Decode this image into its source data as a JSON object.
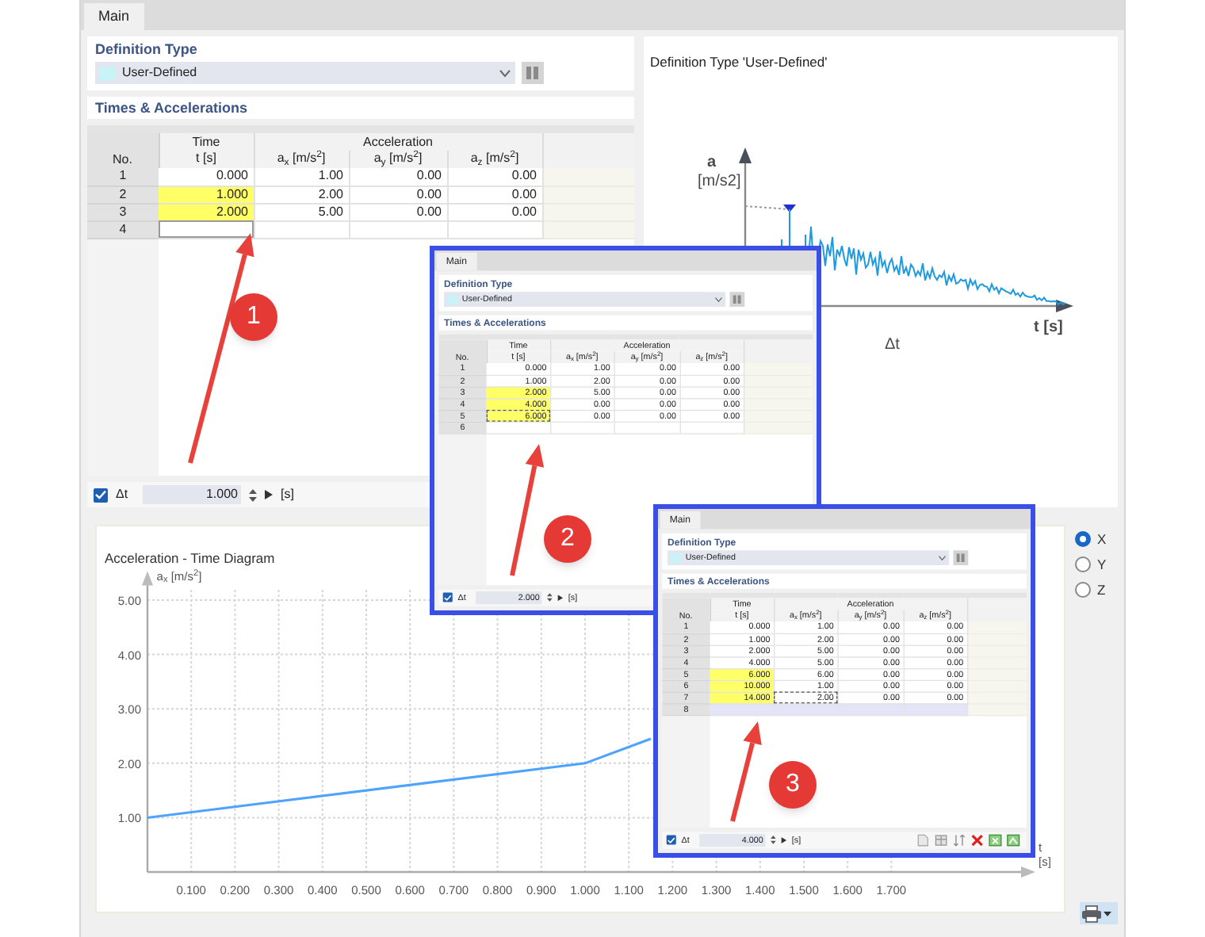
{
  "tabs": [
    {
      "label": "Main",
      "selected": true
    }
  ],
  "editor": {
    "definition_type_label": "Definition Type",
    "definition_type": "User-Defined",
    "table_title": "Times & Accelerations",
    "table": {
      "column_groups": [
        "Time",
        "Acceleration"
      ],
      "columns": [
        "No.",
        "t [s]",
        "a$_{x}$ [m/s$^{2}$]",
        "a$_{y}$ [m/s$^{2}$]",
        "a$_{z}$ [m/s$^{2}$]"
      ],
      "rows": [
        {
          "no": "1",
          "time": "0.000",
          "ax": "1.00",
          "ay": "0.00",
          "az": "0.00",
          "highlighted": false,
          "selected": false,
          "time_focused": false,
          "ax_focused": false
        },
        {
          "no": "2",
          "time": "1.000",
          "ax": "2.00",
          "ay": "0.00",
          "az": "0.00",
          "highlighted": true,
          "selected": false,
          "time_focused": false,
          "ax_focused": false
        },
        {
          "no": "3",
          "time": "2.000",
          "ax": "5.00",
          "ay": "0.00",
          "az": "0.00",
          "highlighted": true,
          "selected": false,
          "time_focused": false,
          "ax_focused": false
        },
        {
          "no": "4",
          "highlighted": false,
          "selected": false,
          "time_focused": true,
          "ax_focused": false
        }
      ]
    },
    "delta_t": {
      "checked": true,
      "label": "Δt",
      "value": "1.000",
      "unit": "[s]"
    }
  },
  "diagram_panel": {
    "title": "Definition Type 'User-Defined'",
    "y_axis_label": "a",
    "y_axis_unit": "[m/s2]",
    "x_axis_label": "t [s]",
    "interval_label": "Δt"
  },
  "chart_panel": {
    "title": "Acceleration - Time Diagram",
    "chart_data": {
      "type": "line",
      "xlabel": "t [s]",
      "ylabel": "a$_{x}$ [m/s$^{2}$]",
      "x": [
        0,
        1,
        1.15
      ],
      "series": [
        {
          "color": "#4da3ff",
          "values": [
            1,
            2,
            2.45
          ]
        }
      ],
      "xlim": [
        0,
        2
      ],
      "ylim": [
        0,
        5.3
      ],
      "grid": true,
      "xticks": [
        {
          "value": 0.1,
          "label": "0.100"
        },
        {
          "value": 0.2,
          "label": "0.200"
        },
        {
          "value": 0.3,
          "label": "0.300"
        },
        {
          "value": 0.4,
          "label": "0.400"
        },
        {
          "value": 0.5,
          "label": "0.500"
        },
        {
          "value": 0.6,
          "label": "0.600"
        },
        {
          "value": 0.7,
          "label": "0.700"
        },
        {
          "value": 0.8,
          "label": "0.800"
        },
        {
          "value": 0.9,
          "label": "0.900"
        },
        {
          "value": 1.0,
          "label": "1.000"
        },
        {
          "value": 1.1,
          "label": "1.100"
        },
        {
          "value": 1.2,
          "label": "1.200"
        },
        {
          "value": 1.3,
          "label": "1.300"
        },
        {
          "value": 1.4,
          "label": "1.400"
        },
        {
          "value": 1.5,
          "label": "1.500"
        },
        {
          "value": 1.6,
          "label": "1.600"
        },
        {
          "value": 1.7,
          "label": "1.700"
        }
      ],
      "yticks": [
        {
          "value": 1,
          "label": "1.00"
        },
        {
          "value": 2,
          "label": "2.00"
        },
        {
          "value": 3,
          "label": "3.00"
        },
        {
          "value": 4,
          "label": "4.00"
        },
        {
          "value": 5,
          "label": "5.00"
        }
      ]
    }
  },
  "direction_options": [
    {
      "label": "X",
      "selected": true
    },
    {
      "label": "Y",
      "selected": false
    },
    {
      "label": "Z",
      "selected": false
    }
  ],
  "screenshots": [
    {
      "tabs": [
        {
          "label": "Main",
          "selected": true
        }
      ],
      "editor": {
        "definition_type_label": "Definition Type",
        "definition_type": "User-Defined",
        "table_title": "Times & Accelerations",
        "table": {
          "column_groups": [
            "Time",
            "Acceleration"
          ],
          "columns": [
            "No.",
            "t [s]",
            "a$_{x}$ [m/s$^{2}$]",
            "a$_{y}$ [m/s$^{2}$]",
            "a$_{z}$ [m/s$^{2}$]"
          ],
          "rows": [
            {
              "no": "1",
              "time": "0.000",
              "ax": "1.00",
              "ay": "0.00",
              "az": "0.00",
              "highlighted": false,
              "selected": false,
              "time_focused": false,
              "ax_focused": false
            },
            {
              "no": "2",
              "time": "1.000",
              "ax": "2.00",
              "ay": "0.00",
              "az": "0.00",
              "highlighted": false,
              "selected": false,
              "time_focused": false,
              "ax_focused": false
            },
            {
              "no": "3",
              "time": "2.000",
              "ax": "5.00",
              "ay": "0.00",
              "az": "0.00",
              "highlighted": true,
              "selected": false,
              "time_focused": false,
              "ax_focused": false
            },
            {
              "no": "4",
              "time": "4.000",
              "ax": "0.00",
              "ay": "0.00",
              "az": "0.00",
              "highlighted": true,
              "selected": false,
              "time_focused": false,
              "ax_focused": false
            },
            {
              "no": "5",
              "time": "6.000",
              "ax": "0.00",
              "ay": "0.00",
              "az": "0.00",
              "highlighted": true,
              "selected": false,
              "time_focused": true,
              "ax_focused": false
            },
            {
              "no": "6",
              "highlighted": false,
              "selected": false,
              "time_focused": false,
              "ax_focused": false
            }
          ]
        },
        "delta_t": {
          "checked": true,
          "label": "Δt",
          "value": "2.000",
          "unit": "[s]"
        }
      }
    },
    {
      "tabs": [
        {
          "label": "Main",
          "selected": true
        }
      ],
      "editor": {
        "definition_type_label": "Definition Type",
        "definition_type": "User-Defined",
        "table_title": "Times & Accelerations",
        "show_toolbar": true,
        "table": {
          "column_groups": [
            "Time",
            "Acceleration"
          ],
          "columns": [
            "No.",
            "t [s]",
            "a$_{x}$ [m/s$^{2}$]",
            "a$_{y}$ [m/s$^{2}$]",
            "a$_{z}$ [m/s$^{2}$]"
          ],
          "rows": [
            {
              "no": "1",
              "time": "0.000",
              "ax": "1.00",
              "ay": "0.00",
              "az": "0.00",
              "highlighted": false,
              "selected": false,
              "time_focused": false,
              "ax_focused": false
            },
            {
              "no": "2",
              "time": "1.000",
              "ax": "2.00",
              "ay": "0.00",
              "az": "0.00",
              "highlighted": false,
              "selected": false,
              "time_focused": false,
              "ax_focused": false
            },
            {
              "no": "3",
              "time": "2.000",
              "ax": "5.00",
              "ay": "0.00",
              "az": "0.00",
              "highlighted": false,
              "selected": false,
              "time_focused": false,
              "ax_focused": false
            },
            {
              "no": "4",
              "time": "4.000",
              "ax": "5.00",
              "ay": "0.00",
              "az": "0.00",
              "highlighted": false,
              "selected": false,
              "time_focused": false,
              "ax_focused": false
            },
            {
              "no": "5",
              "time": "6.000",
              "ax": "6.00",
              "ay": "0.00",
              "az": "0.00",
              "highlighted": true,
              "selected": false,
              "time_focused": false,
              "ax_focused": false
            },
            {
              "no": "6",
              "time": "10.000",
              "ax": "1.00",
              "ay": "0.00",
              "az": "0.00",
              "highlighted": true,
              "selected": false,
              "time_focused": false,
              "ax_focused": false
            },
            {
              "no": "7",
              "time": "14.000",
              "ax": "2.00",
              "ay": "0.00",
              "az": "0.00",
              "highlighted": true,
              "selected": false,
              "time_focused": false,
              "ax_focused": true
            },
            {
              "no": "8",
              "highlighted": false,
              "selected": true,
              "time_focused": false,
              "ax_focused": false
            }
          ]
        },
        "delta_t": {
          "checked": true,
          "label": "Δt",
          "value": "4.000",
          "unit": "[s]"
        }
      }
    }
  ],
  "callouts": [
    {
      "number": "1"
    },
    {
      "number": "2"
    },
    {
      "number": "3"
    }
  ]
}
